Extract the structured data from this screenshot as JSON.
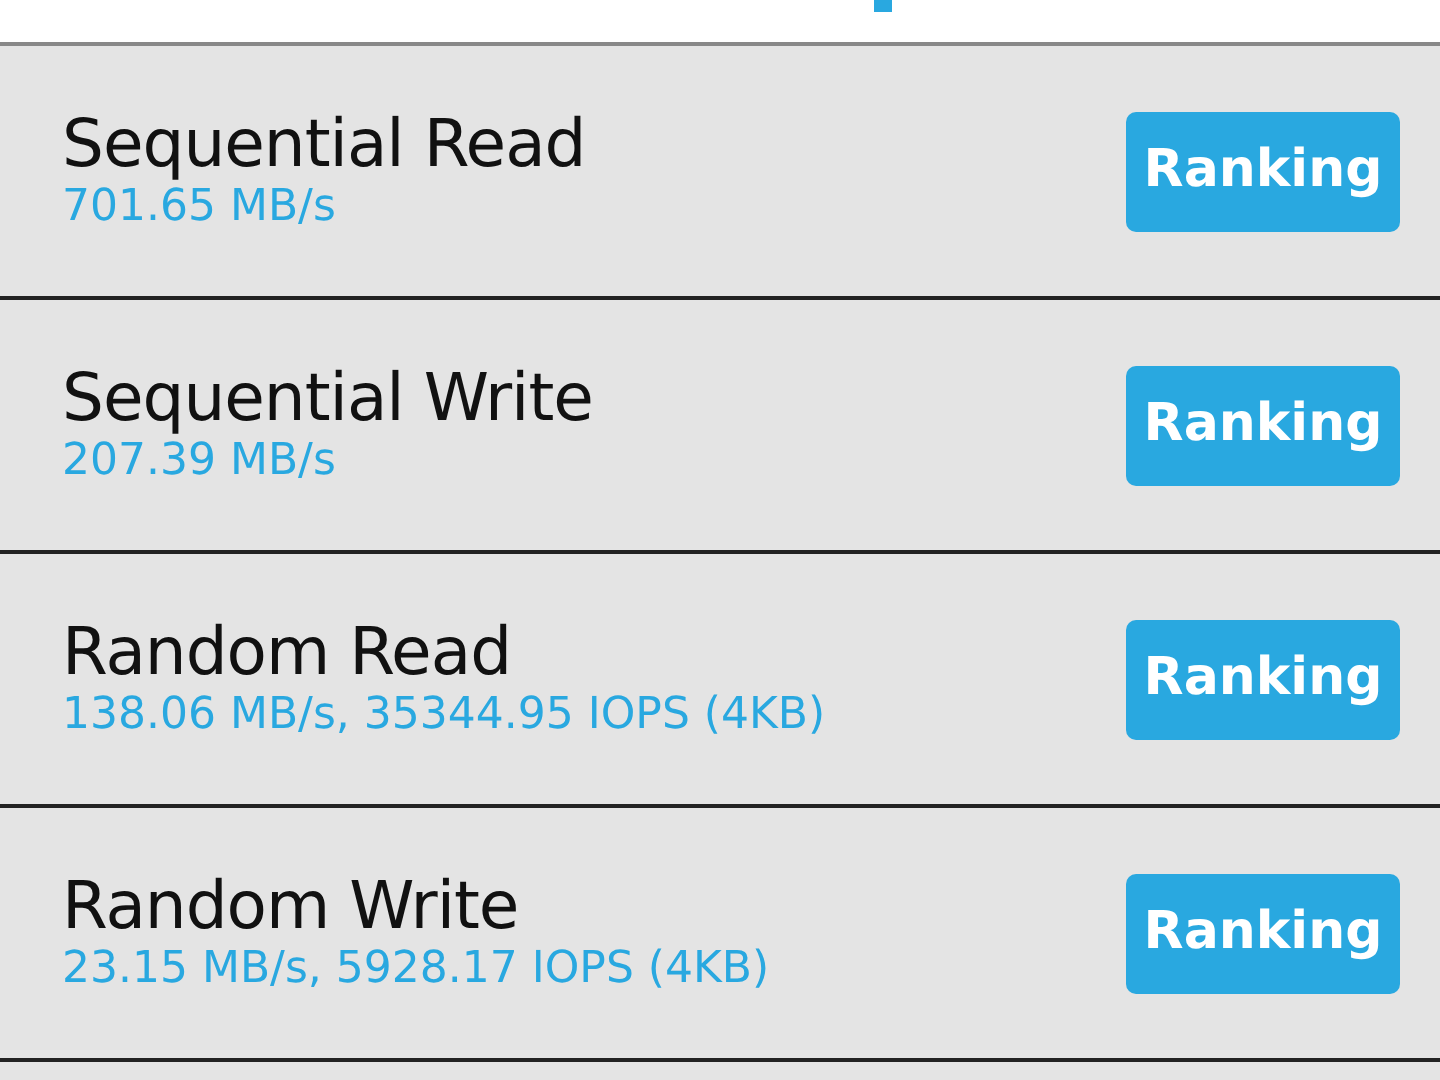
{
  "tests": [
    {
      "title": "Sequential Read",
      "result": "701.65 MB/s",
      "button": "Ranking"
    },
    {
      "title": "Sequential Write",
      "result": "207.39 MB/s",
      "button": "Ranking"
    },
    {
      "title": "Random Read",
      "result": "138.06 MB/s, 35344.95 IOPS (4KB)",
      "button": "Ranking"
    },
    {
      "title": "Random Write",
      "result": "23.15 MB/s, 5928.17 IOPS (4KB)",
      "button": "Ranking"
    }
  ]
}
